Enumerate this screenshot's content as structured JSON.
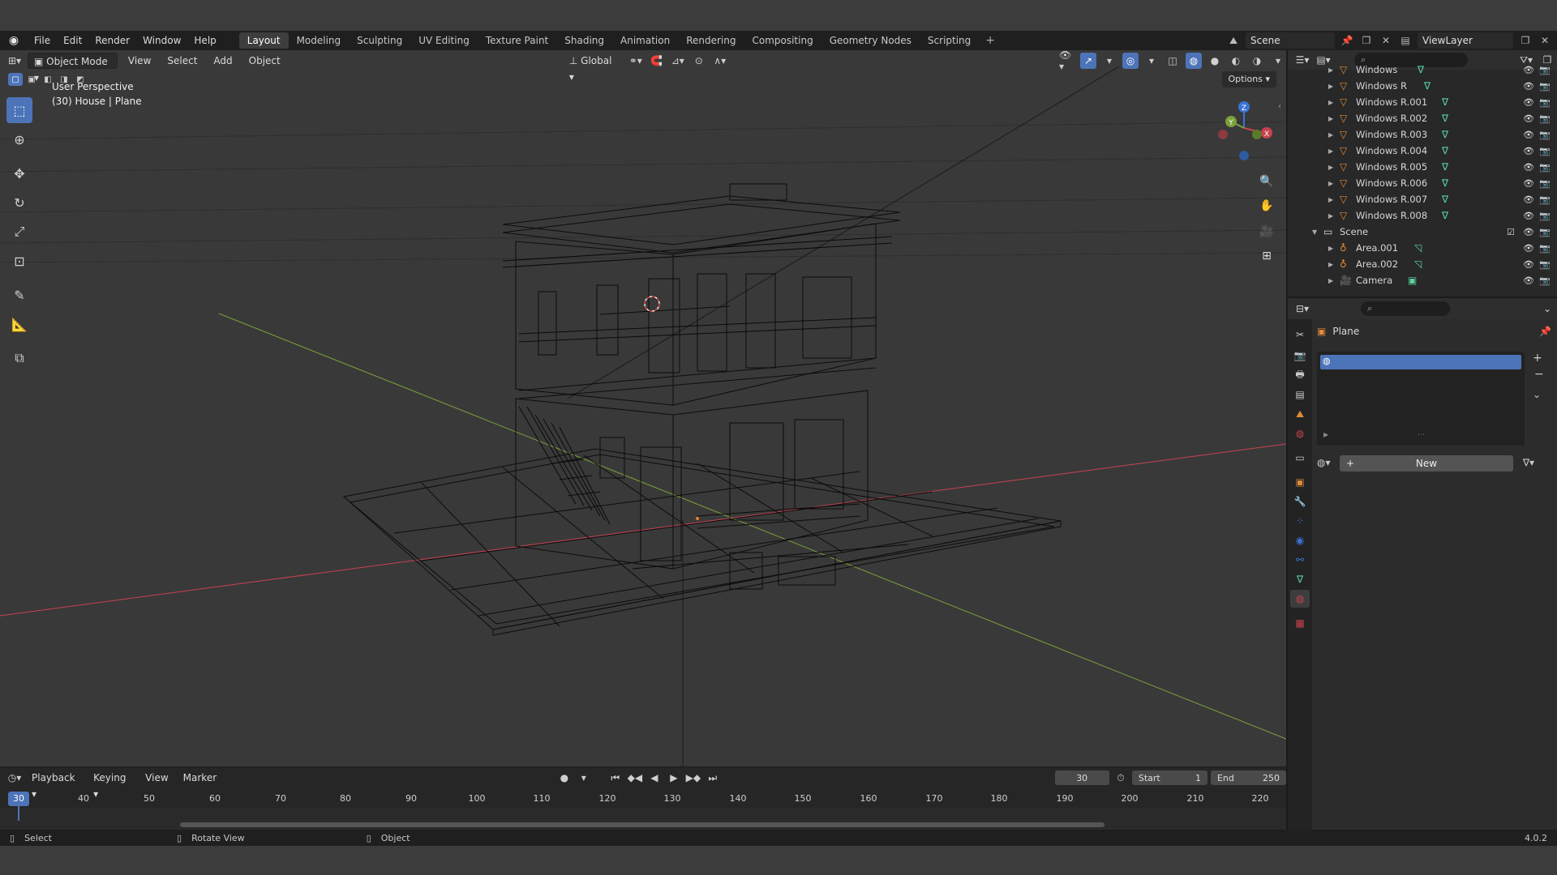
{
  "menubar": {
    "items": [
      "File",
      "Edit",
      "Render",
      "Window",
      "Help"
    ],
    "workspaces": [
      "Layout",
      "Modeling",
      "Sculpting",
      "UV Editing",
      "Texture Paint",
      "Shading",
      "Animation",
      "Rendering",
      "Compositing",
      "Geometry Nodes",
      "Scripting"
    ],
    "active_workspace": "Layout",
    "scene_name": "Scene",
    "view_layer": "ViewLayer"
  },
  "viewport": {
    "mode": "Object Mode",
    "menus": [
      "View",
      "Select",
      "Add",
      "Object"
    ],
    "orientation": "Global",
    "options_label": "Options",
    "info_line1": "User Perspective",
    "info_line2": "(30) House | Plane",
    "gizmo_axes": {
      "z": "Z",
      "y": "Y",
      "x": "X"
    }
  },
  "outliner": {
    "rows": [
      {
        "name": "Windows",
        "type": "mesh"
      },
      {
        "name": "Windows R",
        "type": "mesh"
      },
      {
        "name": "Windows R.001",
        "type": "mesh"
      },
      {
        "name": "Windows R.002",
        "type": "mesh"
      },
      {
        "name": "Windows R.003",
        "type": "mesh"
      },
      {
        "name": "Windows R.004",
        "type": "mesh"
      },
      {
        "name": "Windows R.005",
        "type": "mesh"
      },
      {
        "name": "Windows R.006",
        "type": "mesh"
      },
      {
        "name": "Windows R.007",
        "type": "mesh"
      },
      {
        "name": "Windows R.008",
        "type": "mesh"
      },
      {
        "name": "Scene",
        "type": "collection"
      },
      {
        "name": "Area.001",
        "type": "light"
      },
      {
        "name": "Area.002",
        "type": "light"
      },
      {
        "name": "Camera",
        "type": "camera"
      }
    ]
  },
  "properties": {
    "object_name": "Plane",
    "new_label": "New"
  },
  "timeline": {
    "menus": [
      "Playback",
      "Keying",
      "View",
      "Marker"
    ],
    "current_frame": "30",
    "start_label": "Start",
    "start_value": "1",
    "end_label": "End",
    "end_value": "250",
    "ruler": [
      "40",
      "50",
      "60",
      "70",
      "80",
      "90",
      "100",
      "110",
      "120",
      "130",
      "140",
      "150",
      "160",
      "170",
      "180",
      "190",
      "200",
      "210",
      "220"
    ]
  },
  "statusbar": {
    "select": "Select",
    "rotate": "Rotate View",
    "object": "Object",
    "version": "4.0.2"
  },
  "colors": {
    "accent": "#4d74b8",
    "axis_x": "#c8434f",
    "axis_y": "#7aa23a",
    "axis_z": "#3b74d6",
    "mesh_icon": "#e08a3c",
    "data_icon": "#5bd3a0"
  }
}
